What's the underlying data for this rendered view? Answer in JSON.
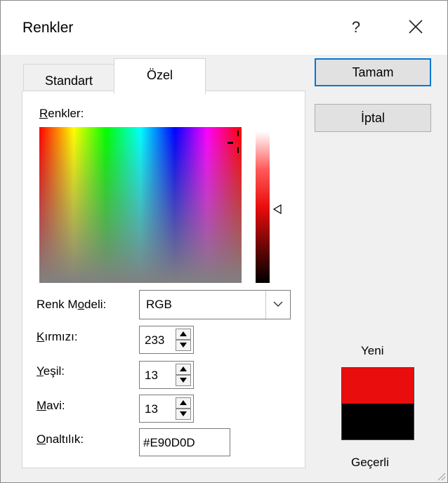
{
  "window": {
    "title": "Renkler",
    "help_label": "?",
    "close_icon": "close-icon"
  },
  "tabs": [
    {
      "label": "Standart",
      "selected": false
    },
    {
      "label": "Özel",
      "selected": true
    }
  ],
  "custom": {
    "colors_label_underlined": "R",
    "colors_label_rest": "enkler:",
    "model_label_a": "Renk M",
    "model_label_u": "o",
    "model_label_b": "deli:",
    "model_value": "RGB",
    "red_label_u": "K",
    "red_label_rest": "ırmızı:",
    "red_value": "233",
    "green_label_u": "Y",
    "green_label_rest": "eşil:",
    "green_value": "13",
    "blue_label_u": "M",
    "blue_label_rest": "avi:",
    "blue_value": "13",
    "hex_label_u": "O",
    "hex_label_rest": "naltılık:",
    "hex_value": "#E90D0D"
  },
  "buttons": {
    "ok": "Tamam",
    "cancel": "İptal"
  },
  "preview": {
    "new_label": "Yeni",
    "current_label": "Geçerli",
    "new_color": "#E90D0D",
    "current_color": "#000000"
  }
}
